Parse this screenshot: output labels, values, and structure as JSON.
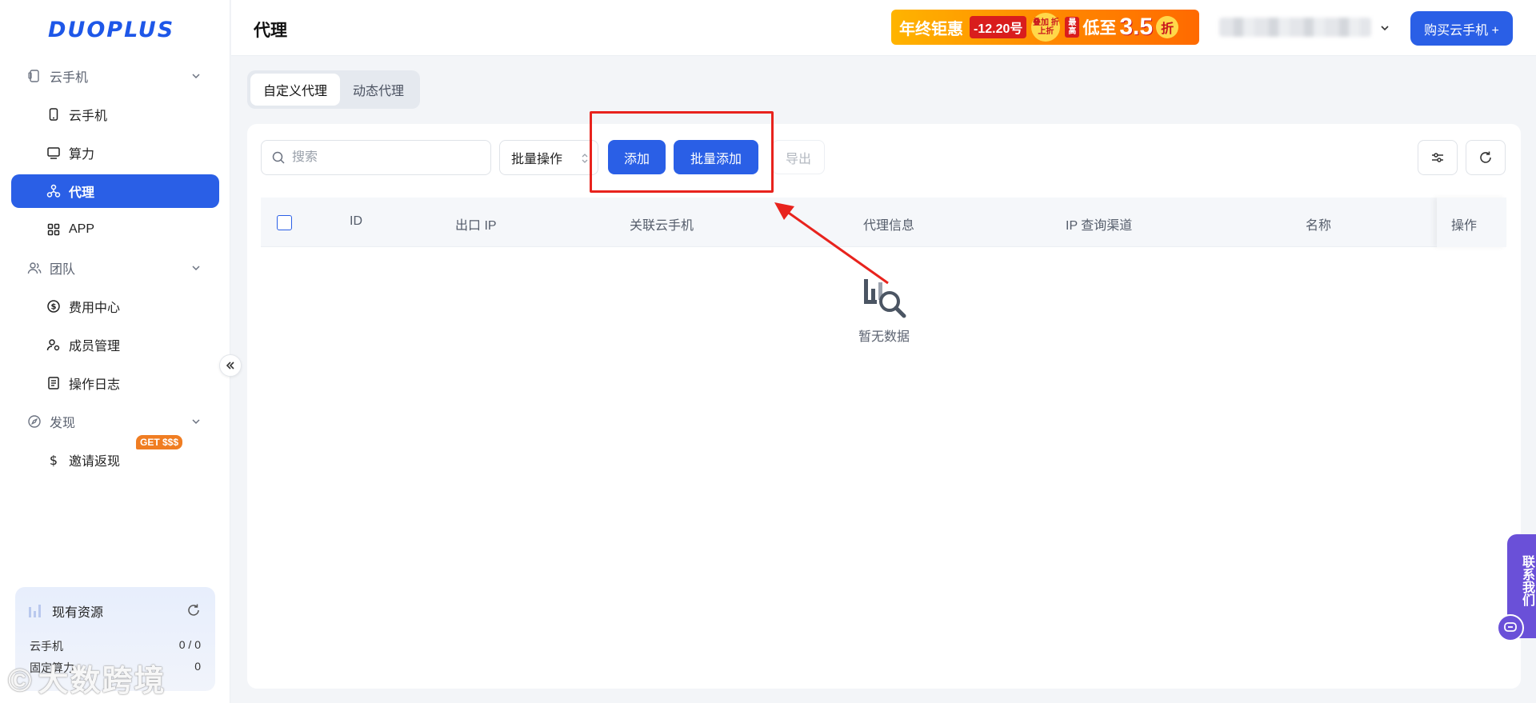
{
  "app": {
    "logo": "DUOPLUS"
  },
  "sidebar": {
    "groups": [
      {
        "label": "云手机",
        "icon": "phone-outline-icon"
      },
      {
        "label": "团队",
        "icon": "users-icon"
      },
      {
        "label": "发现",
        "icon": "compass-icon"
      }
    ],
    "items": [
      {
        "label": "云手机",
        "icon": "phone-icon"
      },
      {
        "label": "算力",
        "icon": "monitor-icon"
      },
      {
        "label": "代理",
        "icon": "network-icon",
        "active": true
      },
      {
        "label": "APP",
        "icon": "apps-grid-icon"
      },
      {
        "label": "费用中心",
        "icon": "dollar-circle-icon"
      },
      {
        "label": "成员管理",
        "icon": "member-icon"
      },
      {
        "label": "操作日志",
        "icon": "log-icon"
      },
      {
        "label": "邀请返现",
        "icon": "dollar-icon",
        "badge": "GET $$$"
      }
    ],
    "resources": {
      "title": "现有资源",
      "rows": [
        {
          "label": "云手机",
          "value": "0 / 0"
        },
        {
          "label": "固定算力",
          "value": "0"
        }
      ]
    },
    "watermark": "大数跨境"
  },
  "header": {
    "title": "代理",
    "promo": {
      "text1": "年终钜惠",
      "date": "-12.20号",
      "stack": "叠加 折上折",
      "highest": "最高",
      "low": "低至",
      "number": "3.5",
      "zhe": "折"
    },
    "buy_button": "购买云手机 +"
  },
  "tabs": [
    {
      "label": "自定义代理",
      "active": true
    },
    {
      "label": "动态代理",
      "active": false
    }
  ],
  "toolbar": {
    "search_placeholder": "搜索",
    "batch_ops": "批量操作",
    "add": "添加",
    "batch_add": "批量添加",
    "export": "导出"
  },
  "table": {
    "columns": [
      "ID",
      "出口 IP",
      "关联云手机",
      "代理信息",
      "IP 查询渠道",
      "名称",
      "操作"
    ],
    "rows": [],
    "empty_text": "暂无数据"
  },
  "contact": {
    "label": "联系我们"
  },
  "colors": {
    "primary": "#2a5fe6",
    "highlight": "#e8231d",
    "contact": "#6a50d8"
  }
}
